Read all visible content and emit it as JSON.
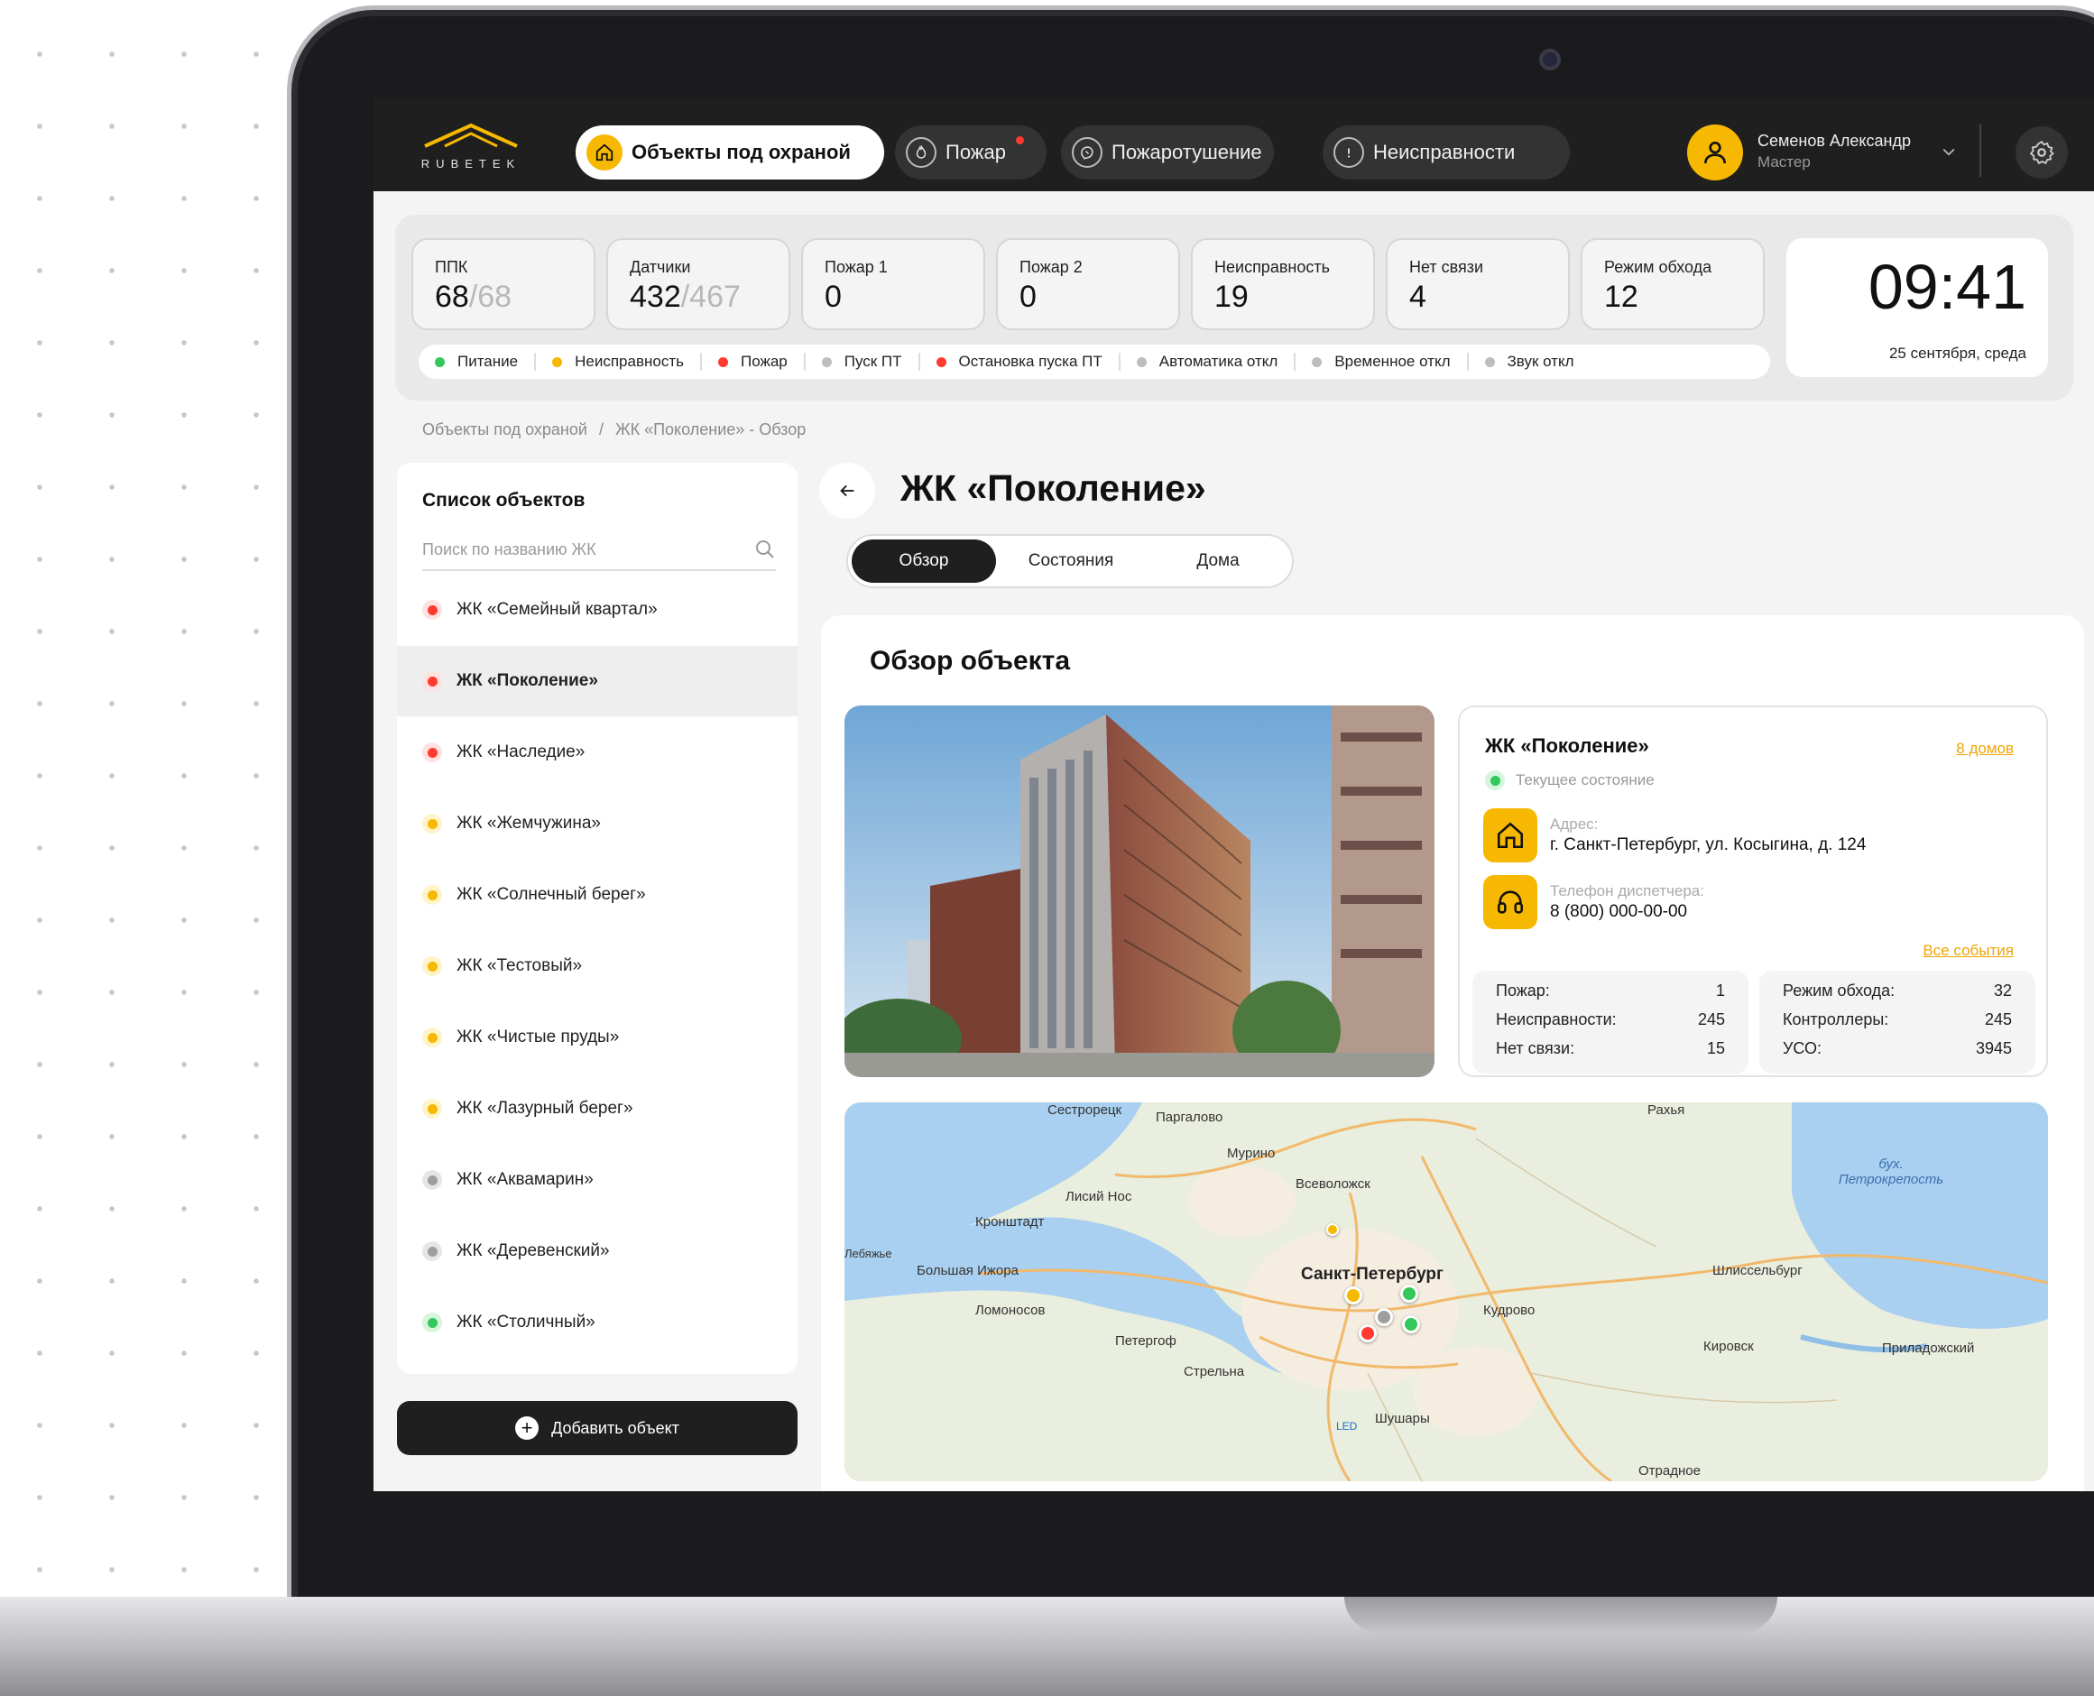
{
  "app": {
    "logo_text": "RUBETEK"
  },
  "nav": [
    {
      "label": "Объекты под охраной",
      "icon": "home-icon",
      "active": true
    },
    {
      "label": "Пожар",
      "icon": "flame-icon",
      "active": false,
      "alert": true
    },
    {
      "label": "Пожаротушение",
      "icon": "extinguisher-icon",
      "active": false
    },
    {
      "label": "Неисправности",
      "icon": "alert-circle-icon",
      "active": false
    }
  ],
  "user": {
    "name": "Семенов Александр",
    "role": "Мастер"
  },
  "stats": [
    {
      "label": "ППК",
      "value": "68",
      "total": "/68"
    },
    {
      "label": "Датчики",
      "value": "432",
      "total": "/467"
    },
    {
      "label": "Пожар 1",
      "value": "0",
      "total": ""
    },
    {
      "label": "Пожар 2",
      "value": "0",
      "total": ""
    },
    {
      "label": "Неисправность",
      "value": "19",
      "total": ""
    },
    {
      "label": "Нет связи",
      "value": "4",
      "total": ""
    },
    {
      "label": "Режим обхода",
      "value": "12",
      "total": ""
    }
  ],
  "legend": [
    {
      "label": "Питание",
      "color": "#34c759"
    },
    {
      "label": "Неисправность",
      "color": "#f6b800"
    },
    {
      "label": "Пожар",
      "color": "#ff3b30"
    },
    {
      "label": "Пуск ПТ",
      "color": "#bdbdbd"
    },
    {
      "label": "Остановка пуска ПТ",
      "color": "#ff3b30"
    },
    {
      "label": "Автоматика откл",
      "color": "#bdbdbd"
    },
    {
      "label": "Временное откл",
      "color": "#bdbdbd"
    },
    {
      "label": "Звук откл",
      "color": "#bdbdbd"
    }
  ],
  "clock": {
    "time": "09:41",
    "date": "25 сентября, среда"
  },
  "breadcrumb": {
    "root": "Объекты под охраной",
    "sep": "/",
    "current": "ЖК «Поколение» - Обзор"
  },
  "sidebar": {
    "title": "Список объектов",
    "search_placeholder": "Поиск по названию ЖК",
    "items": [
      {
        "label": "ЖК «Семейный квартал»",
        "status": "red"
      },
      {
        "label": "ЖК «Поколение»",
        "status": "red",
        "selected": true
      },
      {
        "label": "ЖК «Наследие»",
        "status": "red"
      },
      {
        "label": "ЖК «Жемчужина»",
        "status": "yellow"
      },
      {
        "label": "ЖК «Солнечный берег»",
        "status": "yellow"
      },
      {
        "label": "ЖК «Тестовый»",
        "status": "yellow"
      },
      {
        "label": "ЖК «Чистые пруды»",
        "status": "yellow"
      },
      {
        "label": "ЖК «Лазурный берег»",
        "status": "yellow"
      },
      {
        "label": "ЖК «Аквамарин»",
        "status": "gray"
      },
      {
        "label": "ЖК «Деревенский»",
        "status": "gray"
      },
      {
        "label": "ЖК «Столичный»",
        "status": "green"
      }
    ],
    "add_label": "Добавить объект"
  },
  "status_colors": {
    "red": "#ff3b30",
    "yellow": "#f6b800",
    "gray": "#9e9e9e",
    "green": "#34c759"
  },
  "page": {
    "title": "ЖК «Поколение»"
  },
  "tabs": [
    {
      "label": "Обзор",
      "active": true
    },
    {
      "label": "Состояния",
      "active": false
    },
    {
      "label": "Дома",
      "active": false
    }
  ],
  "overview": {
    "heading": "Обзор объекта",
    "name": "ЖК «Поколение»",
    "houses_link": "8 домов",
    "state_label": "Текущее состояние",
    "address_label": "Адрес:",
    "address": "г. Санкт-Петербург, ул. Косыгина, д. 124",
    "phone_label": "Телефон диспетчера:",
    "phone": "8 (800) 000-00-00",
    "events_link": "Все события",
    "stats_left": [
      {
        "label": "Пожар:",
        "value": "1"
      },
      {
        "label": "Неисправности:",
        "value": "245"
      },
      {
        "label": "Нет связи:",
        "value": "15"
      }
    ],
    "stats_right": [
      {
        "label": "Режим обхода:",
        "value": "32"
      },
      {
        "label": "Контроллеры:",
        "value": "245"
      },
      {
        "label": "УСО:",
        "value": "3945"
      }
    ]
  },
  "map": {
    "labels": [
      "Сестрорецк",
      "Паргалово",
      "Мурино",
      "Всеволожск",
      "Лисий Нос",
      "Кронштадт",
      "Лебяжье",
      "Большая Ижора",
      "Санкт-Петербург",
      "Ломоносов",
      "Петергоф",
      "Стрельна",
      "Кудрово",
      "Шушары",
      "Отрадное",
      "Кировск",
      "Шлиссельбург",
      "Приладожский",
      "Рахья",
      "LED"
    ],
    "water_label": "бух. Петрокрепость",
    "pins": [
      "yellow",
      "gray",
      "green",
      "green",
      "red",
      "yellow"
    ]
  }
}
